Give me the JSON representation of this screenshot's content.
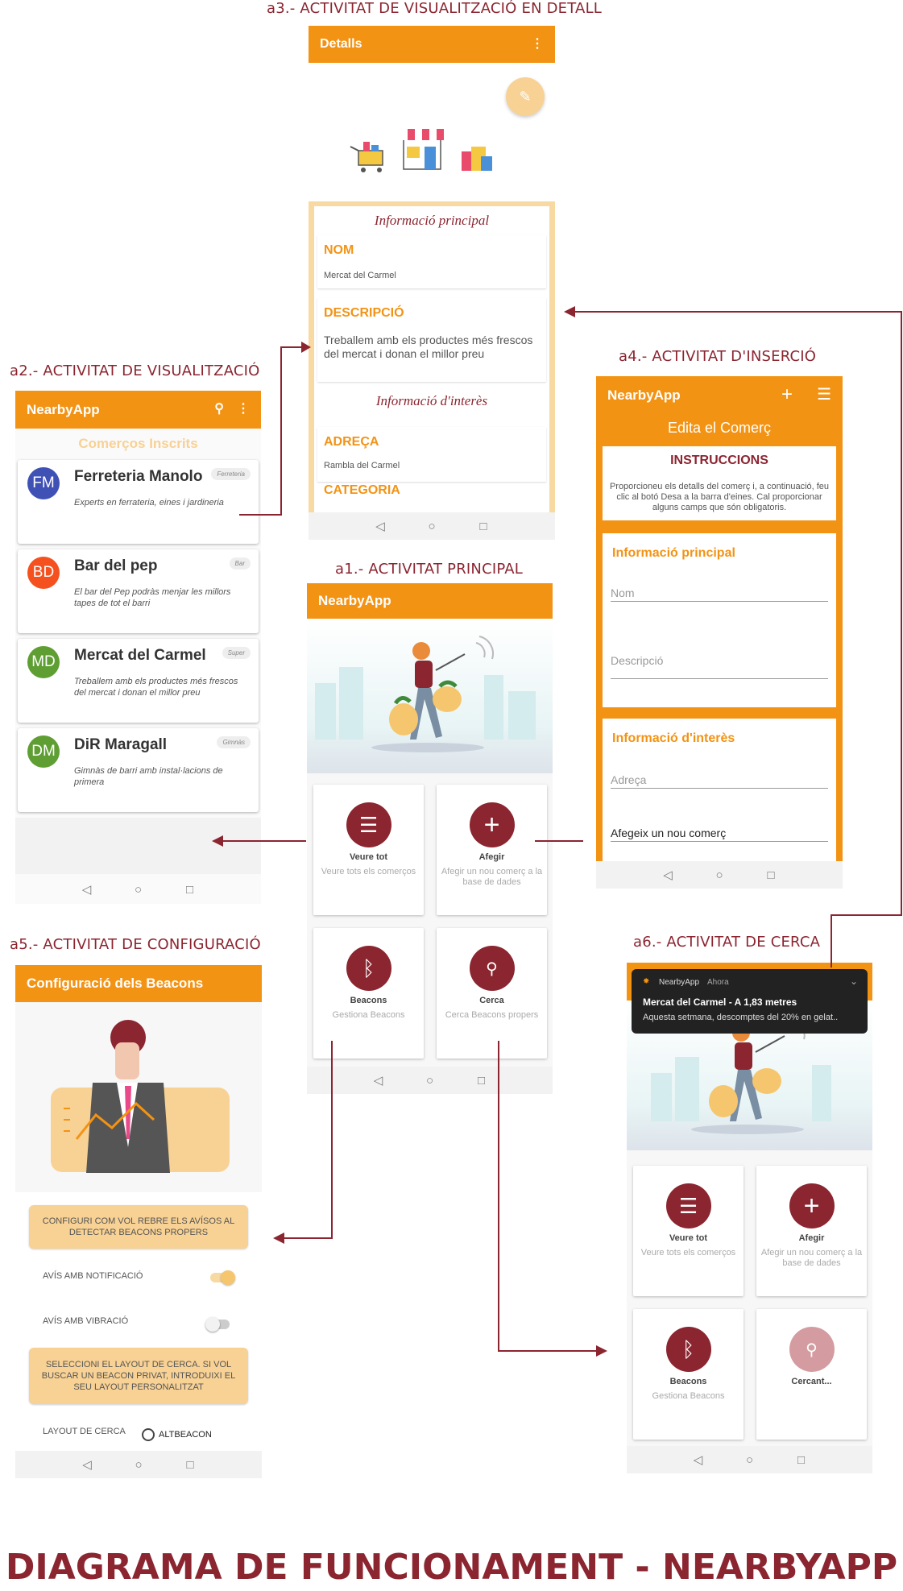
{
  "title": "DIAGRAMA DE FUNCIONAMENT - NEARBYAPP",
  "labels": {
    "a1": "a1.- ACTIVITAT PRINCIPAL",
    "a2": "a2.- ACTIVITAT DE VISUALITZACIÓ",
    "a3": "a3.- ACTIVITAT DE VISUALITZACIÓ EN DETALL",
    "a4": "a4.- ACTIVITAT D'INSERCIÓ",
    "a5": "a5.- ACTIVITAT DE CONFIGURACIÓ",
    "a6": "a6.- ACTIVITAT DE CERCA"
  },
  "app_name": "NearbyApp",
  "colors": {
    "primary": "#f39314",
    "accent": "#8b2530",
    "light": "#f8d194"
  },
  "main": {
    "tiles": [
      {
        "title": "Veure tot",
        "sub": "Veure tots els comerços",
        "icon": "list-icon"
      },
      {
        "title": "Afegir",
        "sub": "Afegir un nou comerç a la base de dades",
        "icon": "plus-icon"
      },
      {
        "title": "Beacons",
        "sub": "Gestiona Beacons",
        "icon": "bluetooth-icon"
      },
      {
        "title": "Cerca",
        "sub": "Cerca Beacons propers",
        "icon": "search-icon"
      }
    ]
  },
  "list": {
    "header": "Comerços Inscrits",
    "items": [
      {
        "initials": "FM",
        "name": "Ferreteria Manolo",
        "tag": "Ferreteria",
        "desc": "Experts en ferrateria, eines i jardineria",
        "color": "#3f51b5"
      },
      {
        "initials": "BD",
        "name": "Bar del pep",
        "tag": "Bar",
        "desc": "El bar del Pep podràs menjar les millors tapes de tot el barri",
        "color": "#f4511e"
      },
      {
        "initials": "MD",
        "name": "Mercat del Carmel",
        "tag": "Super",
        "desc": "Treballem amb els productes més frescos del mercat i donan el millor preu",
        "color": "#5e9e32"
      },
      {
        "initials": "DM",
        "name": "DiR Maragall",
        "tag": "Gimnàs",
        "desc": "Gimnàs de barri amb instal·lacions de primera",
        "color": "#5e9e32"
      }
    ]
  },
  "detail": {
    "bar_title": "Detalls",
    "main_info": "Informació principal",
    "nom_label": "NOM",
    "nom_value": "Mercat del Carmel",
    "desc_label": "DESCRIPCIÓ",
    "desc_value": "Treballem amb els productes més frescos del mercat i donan el millor preu",
    "interest_info": "Informació d'interès",
    "addr_label": "ADREÇA",
    "addr_value": "Rambla del Carmel",
    "cat_label": "CATEGORIA"
  },
  "insert": {
    "subtitle": "Edita el Comerç",
    "instr_title": "INSTRUCCIONS",
    "instr_text": "Proporcioneu els detalls del comerç i, a continuació, feu clic al botó Desa a la barra d'eines. Cal proporcionar alguns camps que són obligatoris.",
    "main_info": "Informació principal",
    "nom_ph": "Nom",
    "desc_ph": "Descripció",
    "interest_info": "Informació d'interès",
    "addr_ph": "Adreça",
    "toast": "Afegeix un nou comerç"
  },
  "config": {
    "bar_title": "Configuració dels Beacons",
    "notice1": "CONFIGURI COM VOL REBRE ELS AVÍSOS AL DETECTAR BEACONS PROPERS",
    "opt1": "AVÍS AMB NOTIFICACIÓ",
    "opt2": "AVÍS AMB VIBRACIÓ",
    "notice2": "SELECCIONI EL LAYOUT DE CERCA. SI VOL BUSCAR UN BEACON PRIVAT, INTRODUIXI EL SEU LAYOUT PERSONALITZAT",
    "layout_label": "LAYOUT DE CERCA",
    "layout_value": "ALTBEACON"
  },
  "search": {
    "notif_app": "NearbyApp",
    "notif_time": "Ahora",
    "notif_title": "Mercat del Carmel - A 1,83 metres",
    "notif_text": "Aquesta setmana, descomptes del 20% en gelat..",
    "searching": "Cercant..."
  }
}
